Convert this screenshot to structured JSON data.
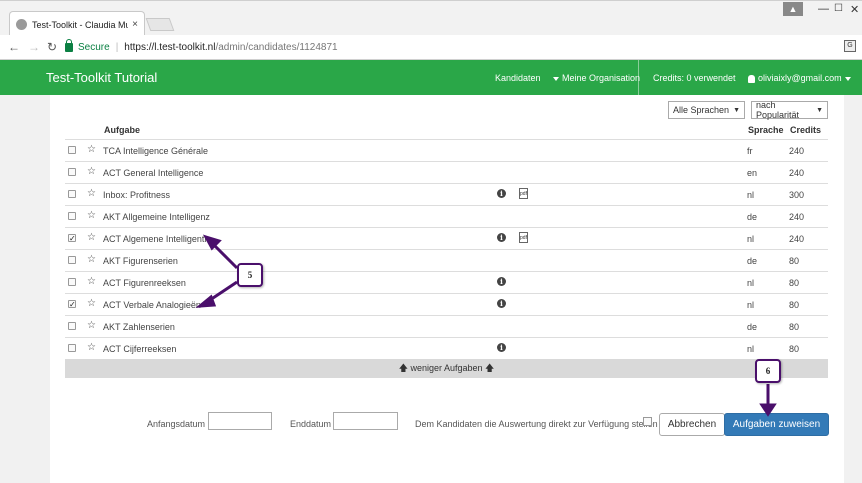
{
  "browser": {
    "tab_title": "Test-Toolkit - Claudia Mu",
    "tab_close": "×",
    "secure_label": "Secure",
    "url_host": "https://l.test-toolkit.nl",
    "url_path": "/admin/candidates/1124871",
    "window_user_glyph": "▲",
    "minimize": "—",
    "maximize": "☐",
    "close": "✕"
  },
  "header": {
    "brand": "Test-Toolkit Tutorial",
    "nav_candidates": "Kandidaten",
    "nav_org": "Meine Organisation",
    "credits": "Credits: 0 verwendet",
    "user_email": "oliviaixly@gmail.com",
    "color": "#2aa748"
  },
  "filters": {
    "language": "Alle Sprachen",
    "sort": "nach Popularität"
  },
  "table": {
    "headers": {
      "task": "Aufgabe",
      "language": "Sprache",
      "credits": "Credits"
    },
    "rows": [
      {
        "checked": false,
        "name": "TCA Intelligence Générale",
        "lang": "fr",
        "credits": "240",
        "info": false,
        "pdf": false
      },
      {
        "checked": false,
        "name": "ACT General Intelligence",
        "lang": "en",
        "credits": "240",
        "info": false,
        "pdf": false
      },
      {
        "checked": false,
        "name": "Inbox: Profitness",
        "lang": "nl",
        "credits": "300",
        "info": true,
        "pdf": true
      },
      {
        "checked": false,
        "name": "AKT Allgemeine Intelligenz",
        "lang": "de",
        "credits": "240",
        "info": false,
        "pdf": false
      },
      {
        "checked": true,
        "name": "ACT Algemene Intelligentie",
        "lang": "nl",
        "credits": "240",
        "info": true,
        "pdf": true
      },
      {
        "checked": false,
        "name": "AKT Figurenserien",
        "lang": "de",
        "credits": "80",
        "info": false,
        "pdf": false
      },
      {
        "checked": false,
        "name": "ACT Figurenreeksen",
        "lang": "nl",
        "credits": "80",
        "info": true,
        "pdf": false
      },
      {
        "checked": true,
        "name": "ACT Verbale Analogieën",
        "lang": "nl",
        "credits": "80",
        "info": true,
        "pdf": false
      },
      {
        "checked": false,
        "name": "AKT Zahlenserien",
        "lang": "de",
        "credits": "80",
        "info": false,
        "pdf": false
      },
      {
        "checked": false,
        "name": "ACT Cijferreeksen",
        "lang": "nl",
        "credits": "80",
        "info": true,
        "pdf": false
      }
    ],
    "fewer_tasks": "weniger Aufgaben"
  },
  "form": {
    "start_label": "Anfangsdatum",
    "end_label": "Enddatum",
    "result_label": "Dem Kandidaten die Auswertung direkt zur Verfügung stellen",
    "cancel_label": "Abbrechen",
    "assign_label": "Aufgaben zuweisen"
  },
  "callouts": {
    "five": "5",
    "six": "6",
    "color": "#4a0f6b"
  }
}
